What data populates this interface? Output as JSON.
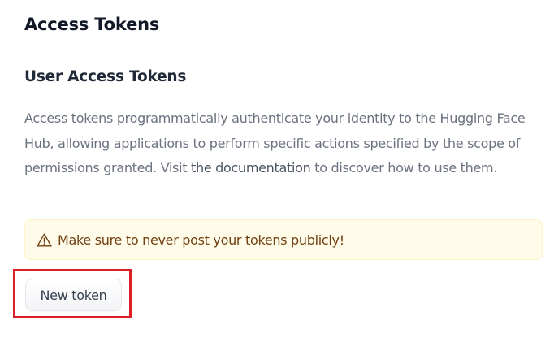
{
  "page": {
    "title": "Access Tokens"
  },
  "user_tokens": {
    "heading": "User Access Tokens",
    "description_before_link": "Access tokens programmatically authenticate your identity to the Hugging Face Hub, allowing applications to perform specific actions specified by the scope of permissions granted. Visit ",
    "documentation_link": "the documentation",
    "description_after_link": " to discover how to use them."
  },
  "warning": {
    "icon": "warning-triangle-icon",
    "text": "Make sure to never post your tokens publicly!",
    "background_color": "#fefce8",
    "text_color": "#713f12"
  },
  "actions": {
    "new_token_label": "New token"
  },
  "annotation": {
    "highlight_color": "#dc1f26"
  }
}
